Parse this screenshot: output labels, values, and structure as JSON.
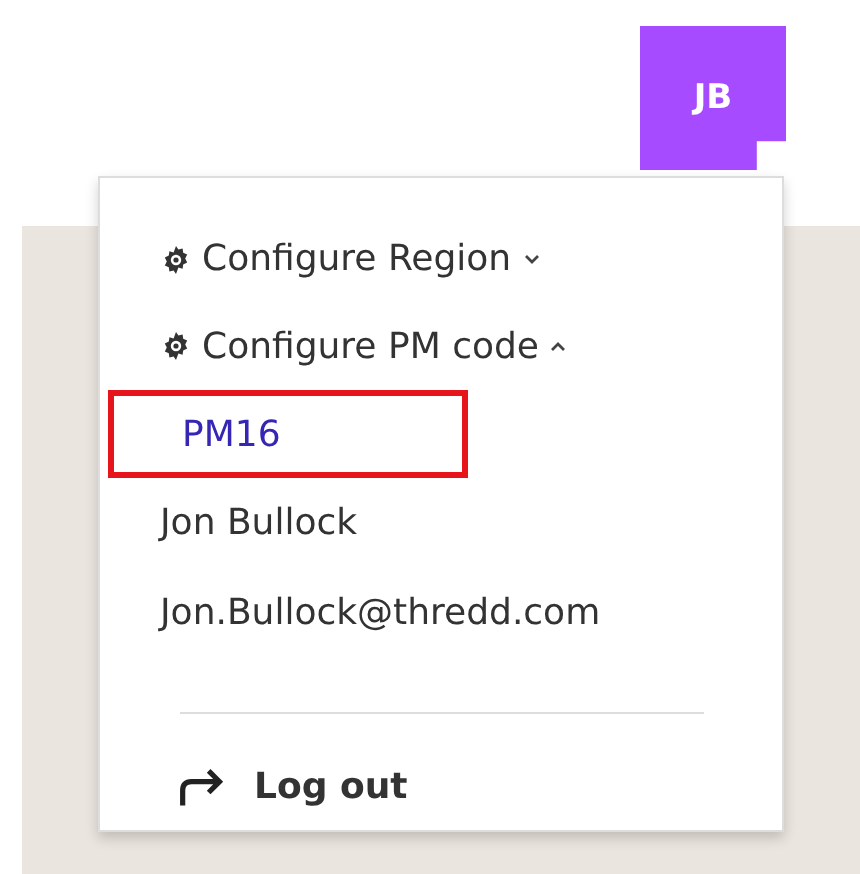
{
  "avatar": {
    "initials": "JB"
  },
  "menu": {
    "items": [
      {
        "kind": "toggle",
        "label": "Configure Region",
        "expanded": false
      },
      {
        "kind": "toggle",
        "label": "Configure PM code",
        "expanded": true
      },
      {
        "kind": "option",
        "label": "PM16",
        "selected": true,
        "highlighted": true
      },
      {
        "kind": "text",
        "label": "Jon Bullock"
      },
      {
        "kind": "text",
        "label": "Jon.Bullock@thredd.com"
      },
      {
        "kind": "divider"
      },
      {
        "kind": "action",
        "label": "Log out"
      }
    ]
  }
}
